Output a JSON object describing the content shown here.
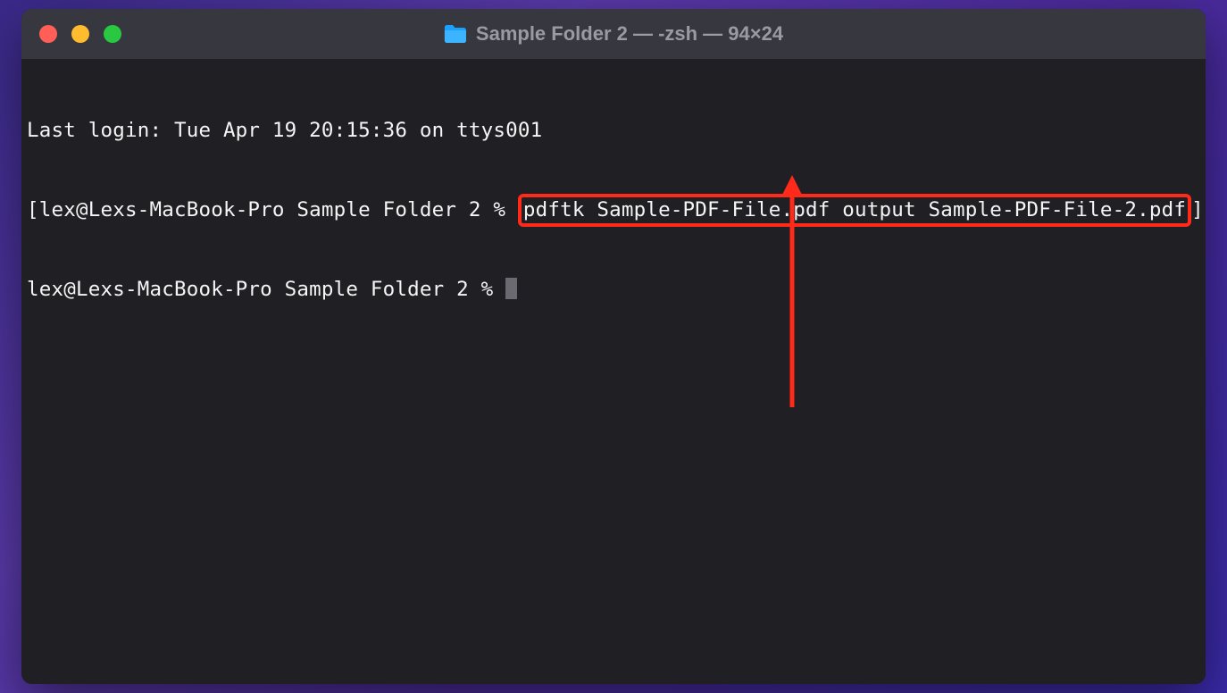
{
  "window": {
    "title": "Sample Folder 2 — -zsh — 94×24"
  },
  "terminal": {
    "last_login": "Last login: Tue Apr 19 20:15:36 on ttys001",
    "line1": {
      "open": "[",
      "prompt": "lex@Lexs-MacBook-Pro Sample Folder 2 % ",
      "highlighted_command": "pdftk Sample-PDF-File.pdf output Sample-PDF-File-2.pdf",
      "close": "]"
    },
    "line2": {
      "prompt": "lex@Lexs-MacBook-Pro Sample Folder 2 % "
    }
  }
}
